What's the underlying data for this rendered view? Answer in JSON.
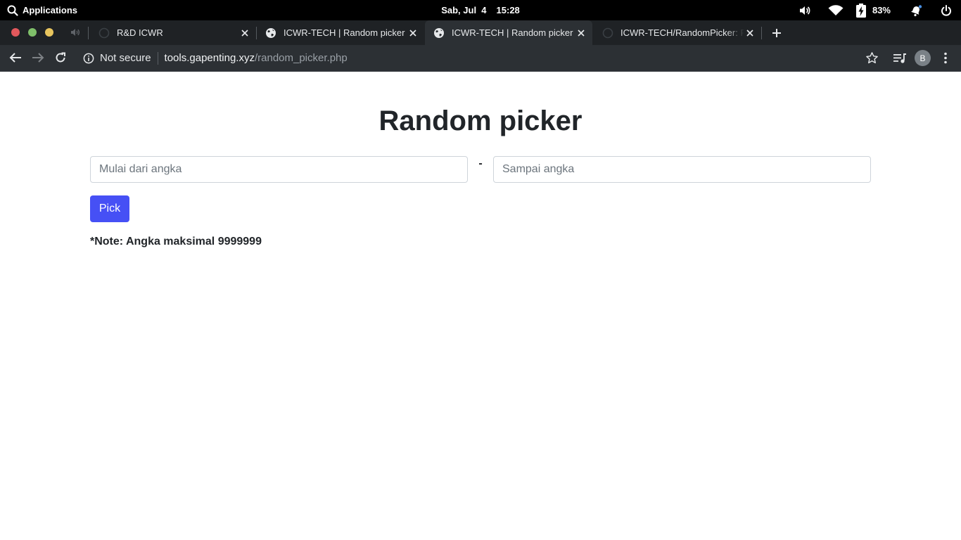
{
  "os_panel": {
    "applications_label": "Applications",
    "date": "Sab, Jul  4",
    "time": "15:28",
    "battery_percent": "83%"
  },
  "browser": {
    "tabs": [
      {
        "title": "R&D ICWR",
        "icon": "github-icon",
        "active": false
      },
      {
        "title": "ICWR-TECH | Random picker",
        "icon": "globe-icon",
        "active": false
      },
      {
        "title": "ICWR-TECH | Random picker",
        "icon": "globe-icon",
        "active": true
      },
      {
        "title": "ICWR-TECH/RandomPicker: Pen",
        "icon": "github-icon",
        "active": false
      }
    ],
    "address": {
      "security_label": "Not secure",
      "host": "tools.gapenting.xyz",
      "path": "/random_picker.php"
    },
    "profile_initial": "B"
  },
  "page": {
    "title": "Random picker",
    "from_placeholder": "Mulai dari angka",
    "to_placeholder": "Sampai angka",
    "separator": "-",
    "pick_label": "Pick",
    "note": "*Note: Angka maksimal 9999999",
    "accent_color": "#4650f5"
  }
}
